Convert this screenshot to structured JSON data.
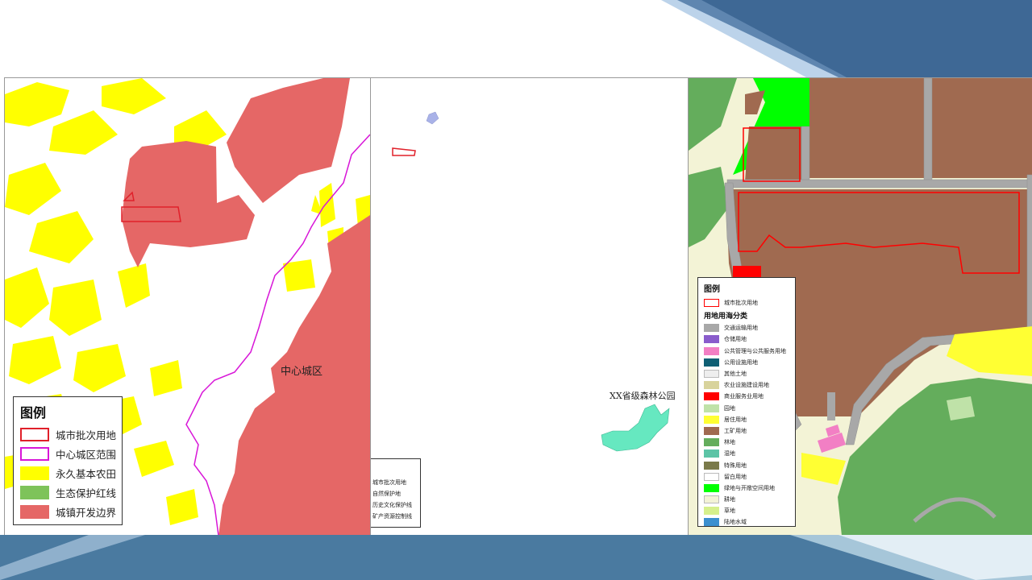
{
  "colors": {
    "banner_dark": "#3e6895",
    "banner_light": "#bcd3ea",
    "bottom_bar": "#4a7aa0",
    "farmland_yellow": "#ffff00",
    "urban_red": "#e56766",
    "boundary_magenta": "#d816d8",
    "batch_red": "#ff0000",
    "forest_park": "#66e8c0"
  },
  "left_map": {
    "label_center": "中心城区",
    "legend": {
      "title": "图例",
      "items": [
        {
          "label": "城市批次用地",
          "style": "outline",
          "color": "#e0202a"
        },
        {
          "label": "中心城区范围",
          "style": "outline",
          "color": "#d816d8"
        },
        {
          "label": "永久基本农田",
          "style": "fill",
          "color": "#ffff00"
        },
        {
          "label": "生态保护红线",
          "style": "fill",
          "color": "#7ec35a"
        },
        {
          "label": "城镇开发边界",
          "style": "fill",
          "color": "#e56766"
        }
      ]
    }
  },
  "mid_map": {
    "label_park": "XX省级森林公园",
    "legend": {
      "items": [
        {
          "label": "城市批次用地"
        },
        {
          "label": "自然保护地"
        },
        {
          "label": "历史文化保护线"
        },
        {
          "label": "矿产资源控制线"
        }
      ]
    }
  },
  "right_map": {
    "legend": {
      "title": "图例",
      "batch_item": {
        "label": "城市批次用地",
        "color": "#ff0000"
      },
      "subtitle": "用地用海分类",
      "items": [
        {
          "label": "交通运输用地",
          "color": "#a8a8a8"
        },
        {
          "label": "仓储用地",
          "color": "#8a5ccc"
        },
        {
          "label": "公共管理与公共服务用地",
          "color": "#f27fc4"
        },
        {
          "label": "公用设施用地",
          "color": "#0f5f74"
        },
        {
          "label": "其他土地",
          "color": "#eeeeee"
        },
        {
          "label": "农业设施建设用地",
          "color": "#d8d39c"
        },
        {
          "label": "商业服务业用地",
          "color": "#ff0000"
        },
        {
          "label": "园地",
          "color": "#bfe2a8"
        },
        {
          "label": "居住用地",
          "color": "#ffff33"
        },
        {
          "label": "工矿用地",
          "color": "#a06a50"
        },
        {
          "label": "林地",
          "color": "#64ad5c"
        },
        {
          "label": "湿地",
          "color": "#5cc4a6"
        },
        {
          "label": "特殊用地",
          "color": "#7a7a4a"
        },
        {
          "label": "留白用地",
          "color": "#ffffff"
        },
        {
          "label": "绿地与开敞空间用地",
          "color": "#00ff00"
        },
        {
          "label": "耕地",
          "color": "#f3f3d6"
        },
        {
          "label": "草地",
          "color": "#d6f08c"
        },
        {
          "label": "陆地水域",
          "color": "#3b8fcf"
        }
      ]
    }
  }
}
